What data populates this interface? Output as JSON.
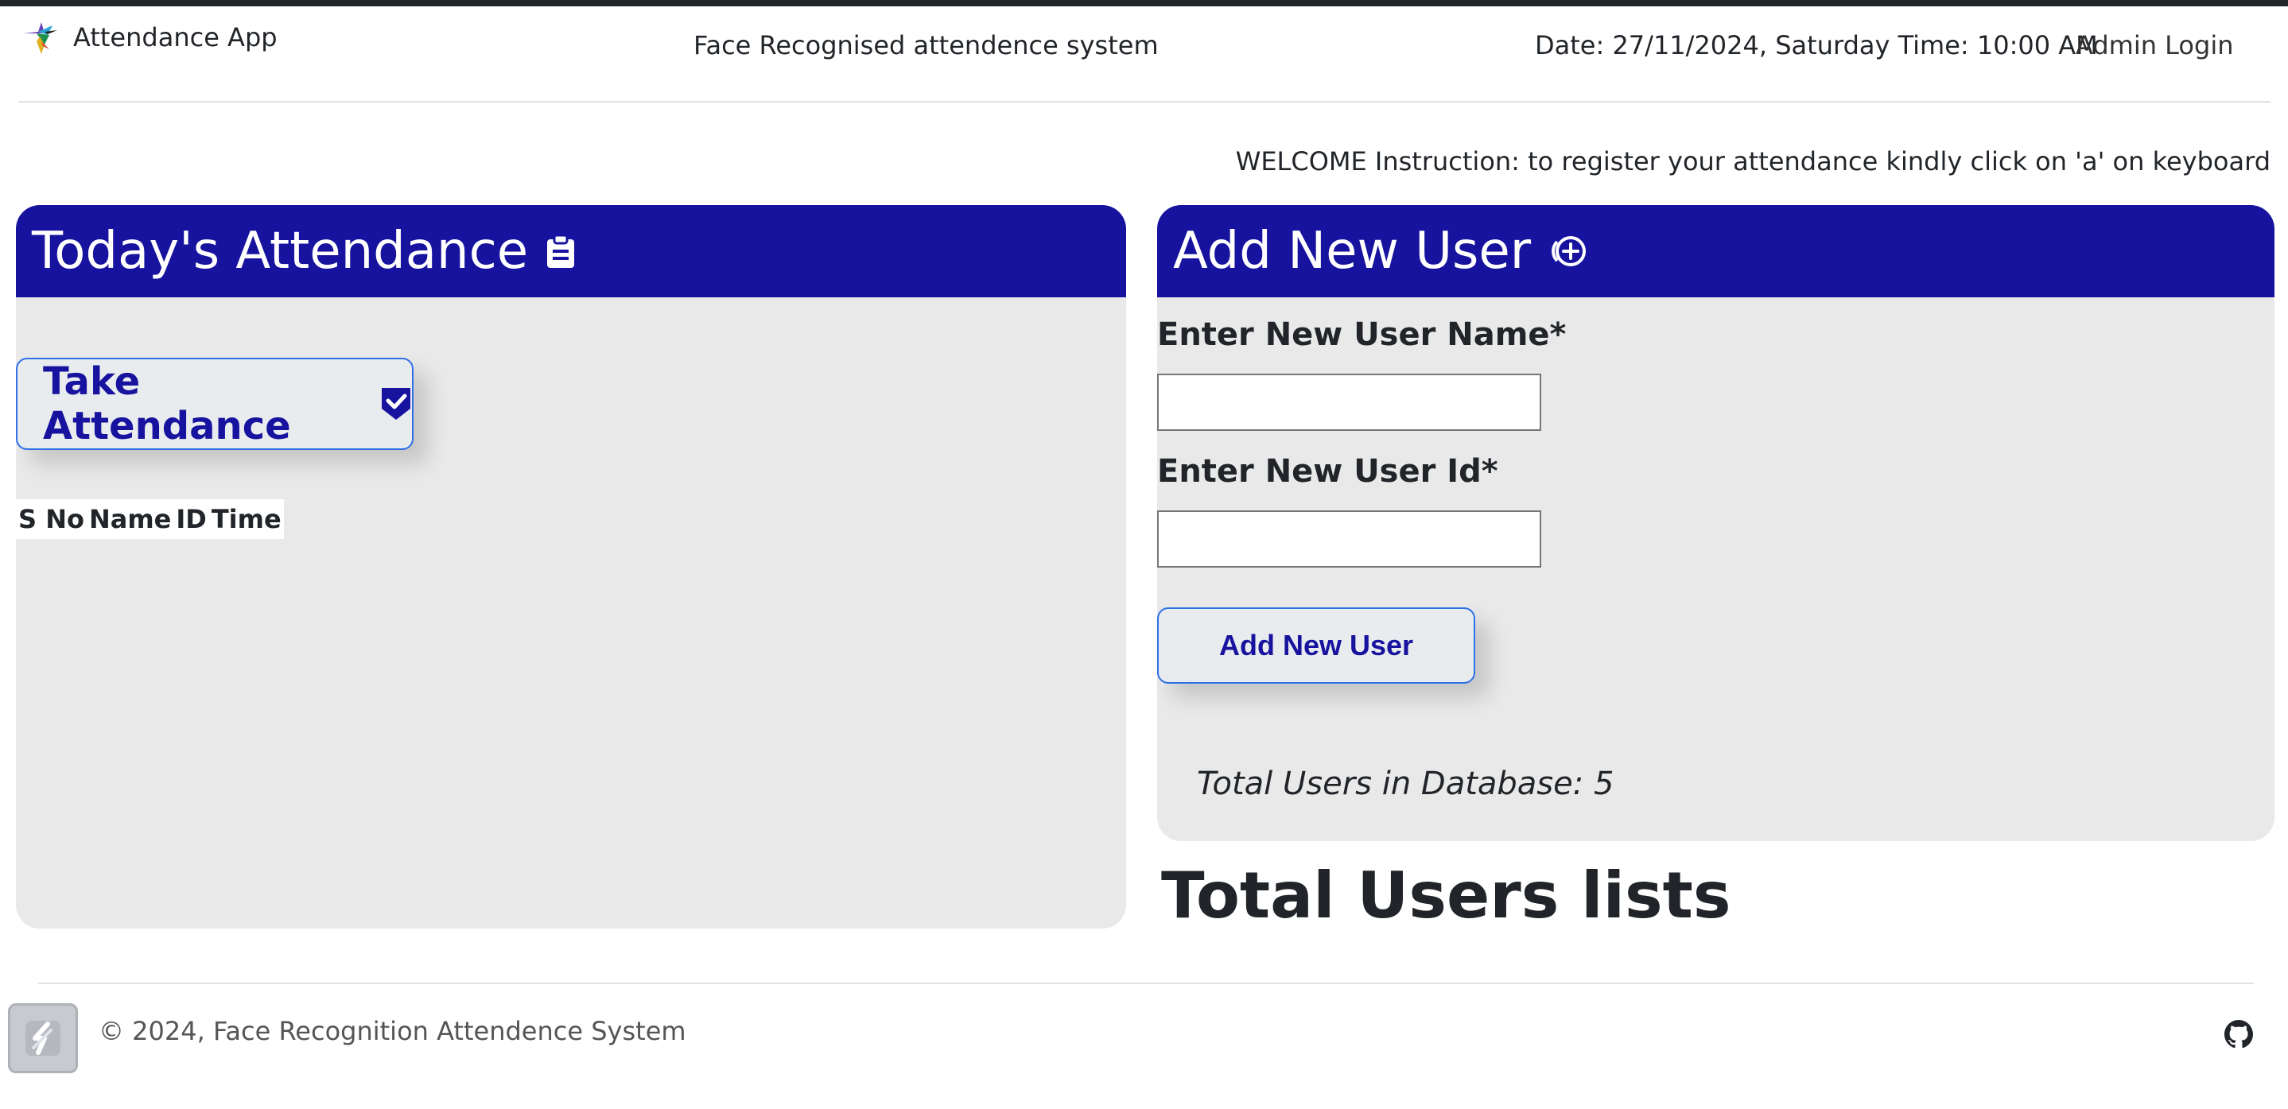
{
  "navbar": {
    "brand": "Attendance App",
    "center_title": "Face Recognised attendence system",
    "datetime": "Date: 27/11/2024, Saturday Time: 10:00 AM",
    "admin_login": "Admin Login"
  },
  "welcome": "WELCOME Instruction: to register your attendance kindly click on 'a' on keyboard",
  "attendance_card": {
    "title": "Today's Attendance",
    "take_button": "Take Attendance",
    "table_headers": [
      "S No",
      "Name",
      "ID",
      "Time"
    ]
  },
  "add_user_card": {
    "title": "Add New User",
    "name_label": "Enter New User Name*",
    "name_value": "",
    "id_label": "Enter New User Id*",
    "id_value": "",
    "add_button": "Add New User",
    "total_users": "Total Users in Database: 5"
  },
  "users_list_title": "Total Users lists",
  "footer": {
    "copyright": "© 2024, Face Recognition Attendence System"
  },
  "colors": {
    "header_blue": "#17139f",
    "card_bg": "#e9e9e9",
    "button_border": "#2e6fe6"
  },
  "icons": {
    "brand": "hummingbird-logo-icon",
    "attendance": "clipboard-icon",
    "take": "shield-check-icon",
    "add_user": "plus-circle-icon",
    "footer_badge": "app-badge-icon",
    "footer_right": "github-icon"
  }
}
